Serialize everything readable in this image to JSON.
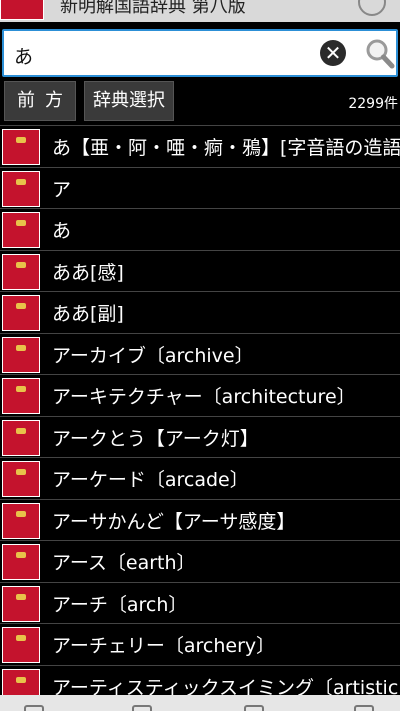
{
  "header": {
    "title": "新明解国語辞典 第八版"
  },
  "search": {
    "value": "あ"
  },
  "toolbar": {
    "prefix_label": "前方",
    "dict_select_label": "辞典選択",
    "result_count": "2299件"
  },
  "dict_icon_text": "新明解国語辞典",
  "results": [
    "あ【亜・阿・唖・痾・鴉】[字音語の造語成分",
    "ア",
    "あ",
    "ああ[感]",
    "ああ[副]",
    "アーカイブ〔archive〕",
    "アーキテクチャー〔architecture〕",
    "アークとう【アーク灯】",
    "アーケード〔arcade〕",
    "アーサかんど【アーサ感度】",
    "アース〔earth〕",
    "アーチ〔arch〕",
    "アーチェリー〔archery〕",
    "アーティスティックスイミング〔artistic swi"
  ],
  "icons": {
    "clear": "clear-icon",
    "search": "search-icon",
    "pen": "pen-icon",
    "dict": "dictionary-icon"
  },
  "colors": {
    "accent": "#2c8fd6",
    "dict_red": "#c4132d",
    "background": "#000000"
  }
}
